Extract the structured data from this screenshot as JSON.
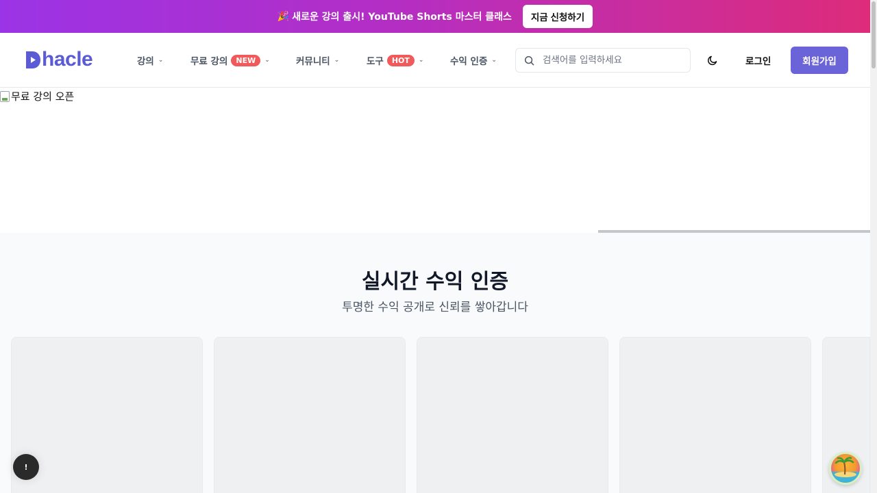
{
  "promo": {
    "emoji": "🎉",
    "text": "새로운 강의 출시! YouTube Shorts 마스터 클래스",
    "cta": "지금 신청하기"
  },
  "header": {
    "logo": "hacle",
    "brand_color": "#5b5bd6",
    "nav": [
      {
        "label": "강의",
        "badge": ""
      },
      {
        "label": "무료 강의",
        "badge": "NEW"
      },
      {
        "label": "커뮤니티",
        "badge": ""
      },
      {
        "label": "도구",
        "badge": "HOT"
      },
      {
        "label": "수익 인증",
        "badge": ""
      }
    ],
    "search_placeholder": "검색어를 입력하세요",
    "theme_icon": "moon-icon",
    "login": "로그인",
    "signup": "회원가입"
  },
  "hero": {
    "image_alt": "무료 강의 오픈",
    "slide_progress": 0.313
  },
  "section": {
    "title": "실시간 수익 인증",
    "subtitle": "투명한 수익 공개로 신뢰를 쌓아갑니다",
    "card_count": 5
  },
  "floating": {
    "left_label": "!",
    "right_icon": "palm-tree-icon"
  },
  "colors": {
    "promo_start": "#9b34e6",
    "promo_end": "#dd2c7a",
    "signup": "#6b63d8",
    "badge": "#f05a5a"
  }
}
